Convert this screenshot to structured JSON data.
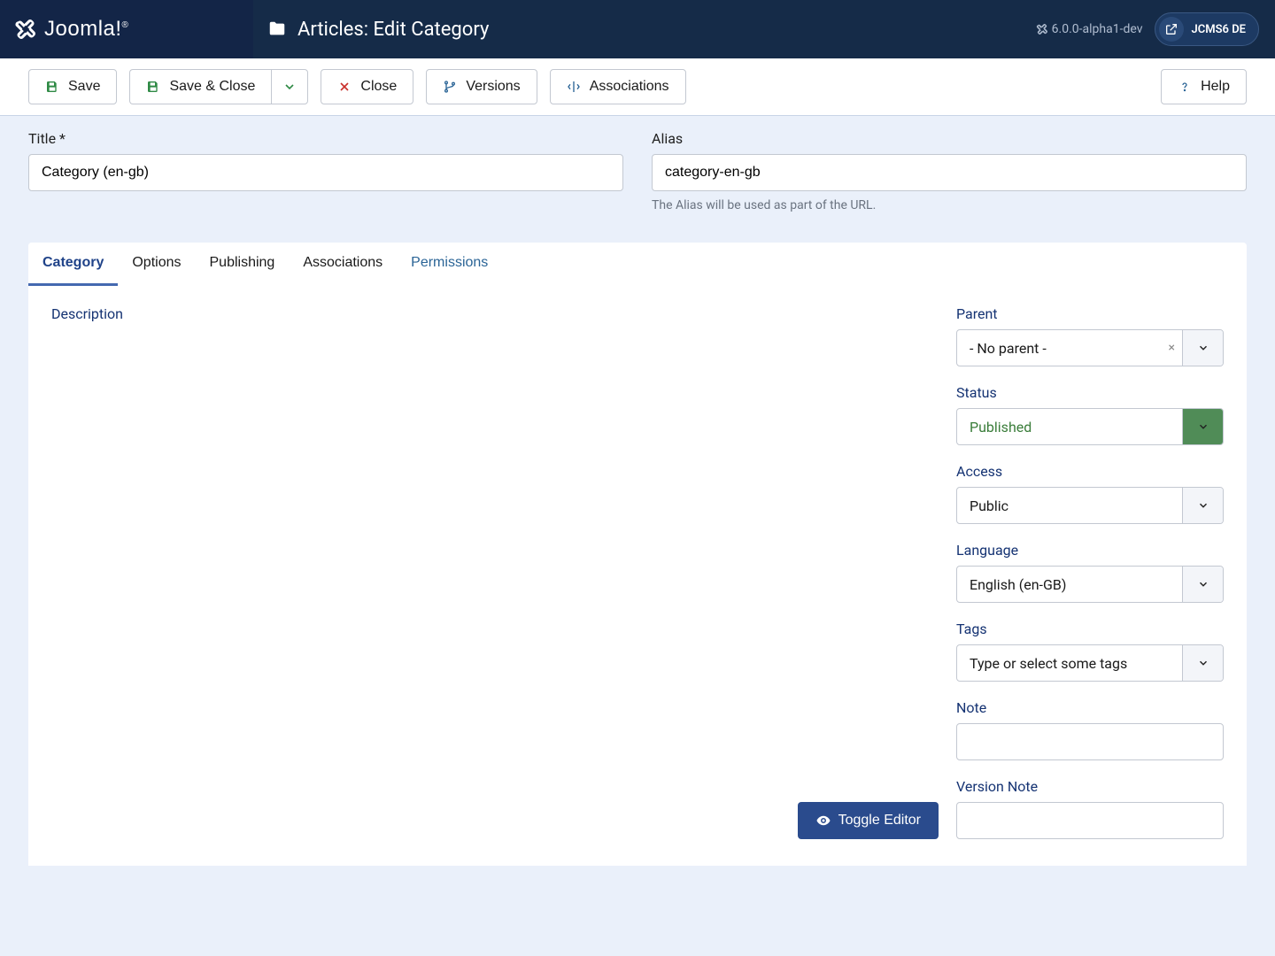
{
  "header": {
    "brand": "Joomla!",
    "page_title": "Articles: Edit Category",
    "version": "6.0.0-alpha1-dev",
    "site_name": "JCMS6 DE"
  },
  "toolbar": {
    "save": "Save",
    "save_close": "Save & Close",
    "close": "Close",
    "versions": "Versions",
    "associations": "Associations",
    "help": "Help"
  },
  "form": {
    "title_label": "Title *",
    "title_value": "Category (en-gb)",
    "alias_label": "Alias",
    "alias_value": "category-en-gb",
    "alias_help": "The Alias will be used as part of the URL."
  },
  "tabs": {
    "category": "Category",
    "options": "Options",
    "publishing": "Publishing",
    "associations": "Associations",
    "permissions": "Permissions"
  },
  "content": {
    "description": "Description",
    "toggle_editor": "Toggle Editor"
  },
  "sidebar": {
    "parent": {
      "label": "Parent",
      "value": "- No parent -"
    },
    "status": {
      "label": "Status",
      "value": "Published"
    },
    "access": {
      "label": "Access",
      "value": "Public"
    },
    "language": {
      "label": "Language",
      "value": "English (en-GB)"
    },
    "tags": {
      "label": "Tags",
      "placeholder": "Type or select some tags"
    },
    "note": {
      "label": "Note"
    },
    "version_note": {
      "label": "Version Note"
    }
  }
}
